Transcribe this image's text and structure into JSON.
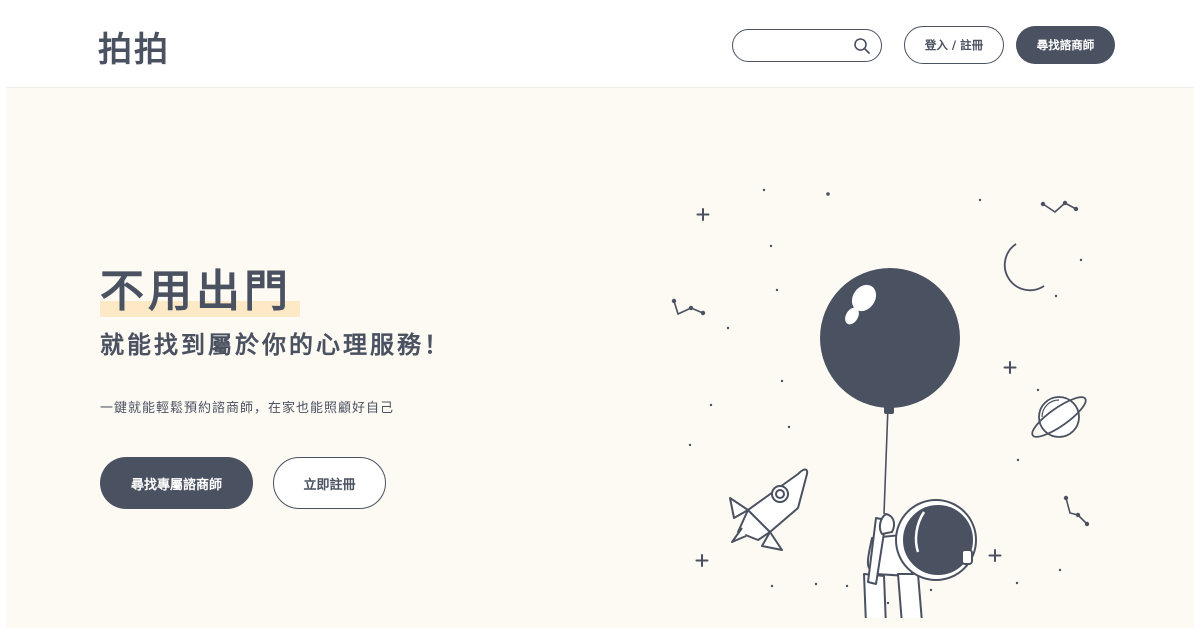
{
  "header": {
    "logo": "拍拍",
    "search": {
      "value": "",
      "placeholder": ""
    },
    "login_label": "登入 / 註冊",
    "find_label": "尋找諮商師"
  },
  "hero": {
    "title": "不用出門",
    "subtitle": "就能找到屬於你的心理服務！",
    "description": "一鍵就能輕鬆預約諮商師，在家也能照顧好自己",
    "primary_button": "尋找專屬諮商師",
    "secondary_button": "立即註冊"
  },
  "colors": {
    "primary": "#4a5160",
    "hero_background": "#fdfaf4",
    "highlight": "#fde9c6"
  },
  "icons": [
    "search-icon",
    "balloon-icon",
    "astronaut-icon",
    "moon-icon",
    "planet-icon",
    "rocket-icon",
    "sparkle-icon",
    "constellation-icon"
  ]
}
